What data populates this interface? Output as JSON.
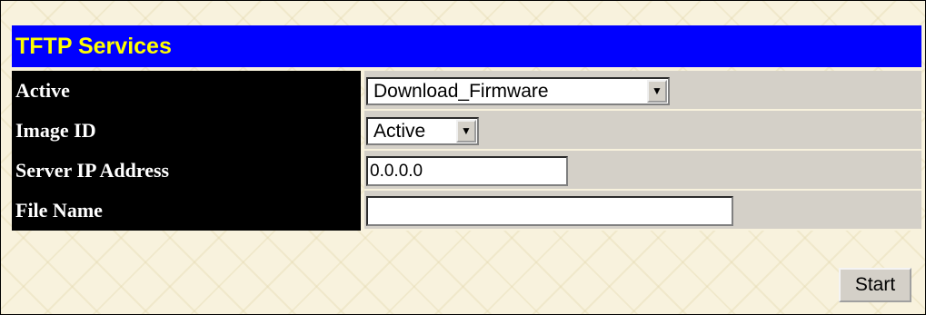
{
  "title": "TFTP Services",
  "fields": [
    {
      "label": "Active",
      "value": "Download_Firmware"
    },
    {
      "label": "Image ID",
      "value": "Active"
    },
    {
      "label": "Server IP Address",
      "value": "0.0.0.0"
    },
    {
      "label": "File Name",
      "value": ""
    }
  ],
  "actions": {
    "start_label": "Start"
  },
  "colors": {
    "header_bg": "#0000FF",
    "header_text": "#FFFF00",
    "label_bg": "#000000",
    "label_text": "#FFFFFF",
    "value_bg": "#D4D0C8"
  },
  "icons": {
    "dropdown": "chevron-down-icon"
  }
}
